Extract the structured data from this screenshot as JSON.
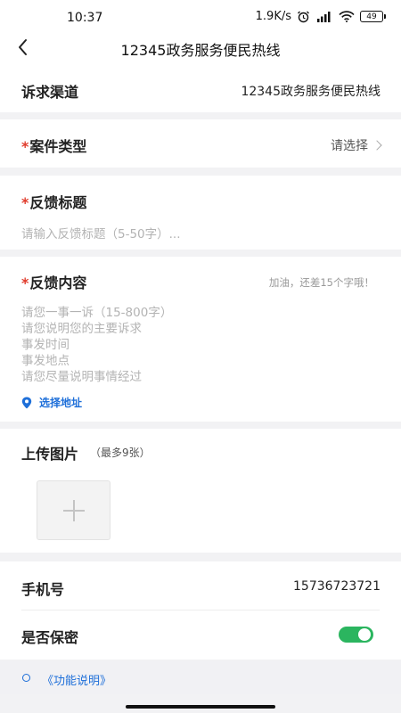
{
  "status_bar": {
    "time": "10:37",
    "net_speed": "1.9K/s",
    "battery": "49"
  },
  "nav": {
    "title": "12345政务服务便民热线"
  },
  "form": {
    "channel": {
      "label": "诉求渠道",
      "value": "12345政务服务便民热线"
    },
    "case_type": {
      "required_mark": "*",
      "label": "案件类型",
      "value": "请选择"
    },
    "feedback_title": {
      "required_mark": "*",
      "label": "反馈标题",
      "placeholder": "请输入反馈标题（5-50字）..."
    },
    "feedback_content": {
      "required_mark": "*",
      "label": "反馈内容",
      "hint": "加油，还差15个字哦！",
      "placeholder_lines": [
        "请您一事一诉（15-800字）",
        "请您说明您的主要诉求",
        "事发时间",
        "事发地点",
        "请您尽量说明事情经过"
      ],
      "location_link": "选择地址"
    },
    "upload": {
      "label": "上传图片",
      "hint": "（最多9张）"
    },
    "phone": {
      "label": "手机号",
      "value": "15736723721"
    },
    "confidential": {
      "label": "是否保密",
      "toggle_on": true
    }
  },
  "footer": {
    "link": "《功能说明》"
  },
  "colors": {
    "required": "#e03b2b",
    "link": "#1e6fd9",
    "toggle_on": "#2bb55f"
  }
}
